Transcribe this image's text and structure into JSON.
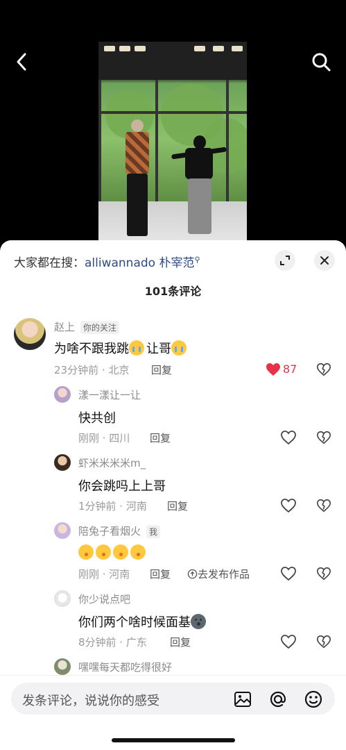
{
  "nav": {
    "back_icon": "chevron-left-icon",
    "search_icon": "search-icon"
  },
  "sheet": {
    "trending_prefix": "大家都在搜：",
    "trending_term": "alliwannado 朴宰范",
    "trending_search_glyph": "⚲",
    "comment_count": "101条评论"
  },
  "comments": [
    {
      "name": "赵上",
      "badge": "你的关注",
      "text": "为啥不跟我跳",
      "text2": "让哥",
      "time": "23分钟前",
      "location": "北京",
      "meta": "23分钟前 · 北京",
      "reply": "回复",
      "liked": true,
      "likes": "87"
    },
    {
      "name": "漾一漾让一让",
      "text": "快共创",
      "meta": "刚刚 · 四川",
      "reply": "回复"
    },
    {
      "name": "虾米米米米m_",
      "text": "你会跳吗上上哥",
      "meta": "1分钟前 · 河南",
      "reply": "回复"
    },
    {
      "name": "陪兔子看烟火",
      "badge": "我",
      "text": "",
      "meta": "刚刚 · 河南",
      "reply": "回复",
      "publish": "去发布作品"
    },
    {
      "name": "你少说点吧",
      "text": "你们两个啥时候面基",
      "meta": "8分钟前 · 广东",
      "reply": "回复"
    },
    {
      "name": "嘿嘿每天都吃得很好"
    }
  ],
  "input": {
    "placeholder": "发条评论，说说你的感受",
    "icons": [
      "image-icon",
      "at-icon",
      "emoji-icon"
    ]
  },
  "colors": {
    "like_red": "#e8324a",
    "link_blue": "#2b4a86"
  }
}
